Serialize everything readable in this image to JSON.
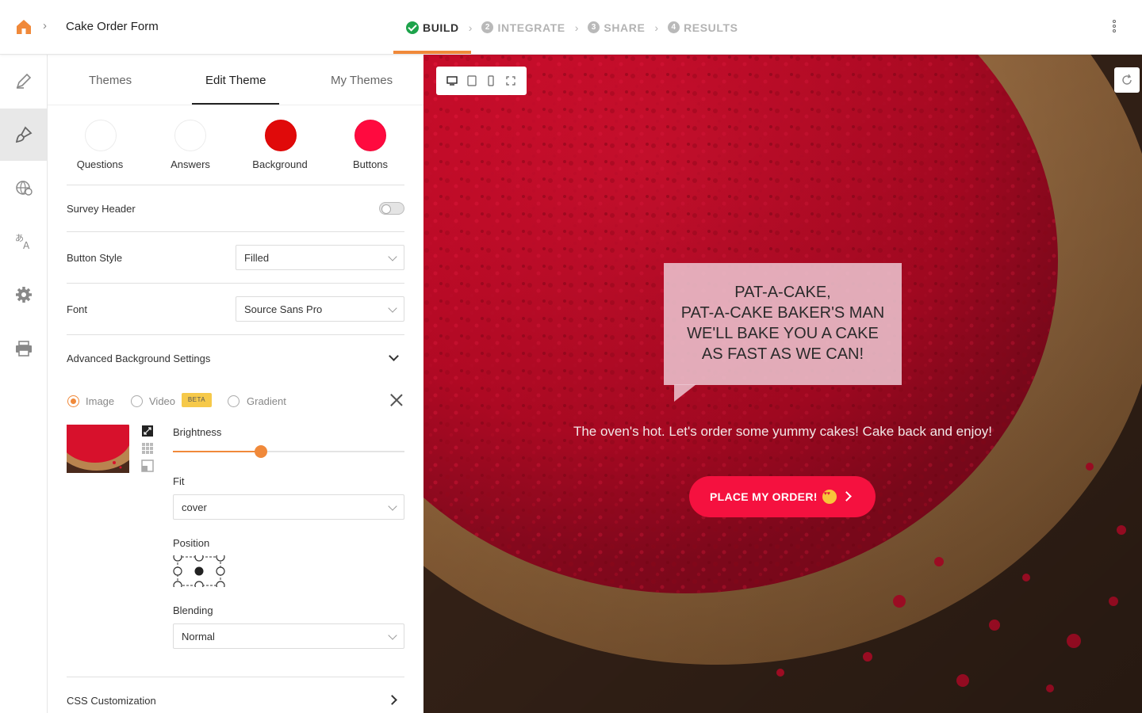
{
  "header": {
    "form_title": "Cake Order Form",
    "breadcrumb_separator": "›",
    "steps": [
      {
        "label": "BUILD",
        "state": "complete"
      },
      {
        "number": "2",
        "label": "INTEGRATE"
      },
      {
        "number": "3",
        "label": "SHARE"
      },
      {
        "number": "4",
        "label": "RESULTS"
      }
    ]
  },
  "rail": {
    "items": [
      {
        "icon": "pen-icon"
      },
      {
        "icon": "paint-brush-icon",
        "active": true
      },
      {
        "icon": "globe-icon"
      },
      {
        "icon": "translate-icon"
      },
      {
        "icon": "gear-icon"
      },
      {
        "icon": "print-icon"
      }
    ]
  },
  "panel": {
    "tabs": [
      "Themes",
      "Edit Theme",
      "My Themes"
    ],
    "active_tab": "Edit Theme",
    "colors": [
      {
        "label": "Questions",
        "color": "#ffffff"
      },
      {
        "label": "Answers",
        "color": "#ffffff"
      },
      {
        "label": "Background",
        "color": "#e00a0a"
      },
      {
        "label": "Buttons",
        "color": "#ff0a3f"
      }
    ],
    "survey_header": {
      "label": "Survey Header",
      "enabled": false
    },
    "button_style": {
      "label": "Button Style",
      "value": "Filled"
    },
    "font": {
      "label": "Font",
      "value": "Source Sans Pro"
    },
    "advanced": {
      "label": "Advanced Background Settings",
      "options": {
        "image": "Image",
        "video": "Video",
        "beta": "BETA",
        "gradient": "Gradient"
      },
      "selected": "Image",
      "brightness": {
        "label": "Brightness",
        "value": 0.38
      },
      "fit": {
        "label": "Fit",
        "value": "cover"
      },
      "position": {
        "label": "Position",
        "selected": "center"
      },
      "blending": {
        "label": "Blending",
        "value": "Normal"
      }
    },
    "css": {
      "label": "CSS Customization"
    }
  },
  "preview": {
    "bubble_text": "PAT-A-CAKE,\nPAT-A-CAKE BAKER'S MAN\nWE'LL BAKE YOU A CAKE\nAS FAST AS WE CAN!",
    "subtitle": "The oven's hot. Let's order some yummy cakes! Cake back and enjoy!",
    "cta_label": "PLACE MY ORDER!",
    "colors": {
      "accent": "#f0893a",
      "cta": "#f5113f",
      "board": "#b88552"
    }
  }
}
